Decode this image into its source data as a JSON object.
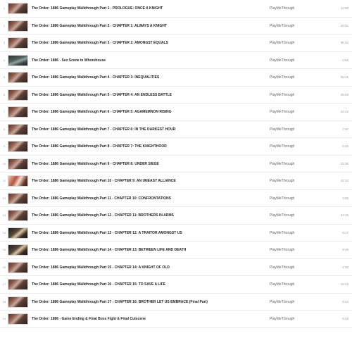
{
  "playlist": {
    "items": [
      {
        "index": "1",
        "title": "The Order: 1886 Gameplay Walkthrough Part 1 - PROLOGUE: ONCE A KNIGHT",
        "channel": "PlayMeThrough",
        "duration": "12:58"
      },
      {
        "index": "2",
        "title": "The Order: 1886 Gameplay Walkthrough Part 2 - CHAPTER 1: ALWAYS A KNIGHT",
        "channel": "PlayMeThrough",
        "duration": "20:01"
      },
      {
        "index": "3",
        "title": "The Order: 1886 Gameplay Walkthrough Part 3 - CHAPTER 2: AMONGST EQUALS",
        "channel": "PlayMeThrough",
        "duration": "35:33"
      },
      {
        "index": "4",
        "title": "The Order: 1886 - Sex Scene in Whorehouse",
        "channel": "PlayMeThrough",
        "duration": "1:56"
      },
      {
        "index": "5",
        "title": "The Order: 1886 Gameplay Walkthrough Part 4 - CHAPTER 3: INEQUALITIES",
        "channel": "PlayMeThrough",
        "duration": "55:41"
      },
      {
        "index": "6",
        "title": "The Order: 1886 Gameplay Walkthrough Part 5 - CHAPTER 4: AN ENDLESS BATTLE",
        "channel": "PlayMeThrough",
        "duration": "26:09"
      },
      {
        "index": "7",
        "title": "The Order: 1886 Gameplay Walkthrough Part 6 - CHAPTER 5: AGAMEMNON RISING",
        "channel": "PlayMeThrough",
        "duration": "22:42"
      },
      {
        "index": "8",
        "title": "The Order: 1886 Gameplay Walkthrough Part 7 - CHAPTER 6: IN THE DARKEST HOUR",
        "channel": "PlayMeThrough",
        "duration": "7:32"
      },
      {
        "index": "9",
        "title": "The Order: 1886 Gameplay Walkthrough Part 8 - CHAPTER 7: THE KNIGHTHOOD",
        "channel": "PlayMeThrough",
        "duration": "6:45"
      },
      {
        "index": "10",
        "title": "The Order: 1886 Gameplay Walkthrough Part 9 - CHAPTER 8: UNDER SIEGE",
        "channel": "PlayMeThrough",
        "duration": "21:38"
      },
      {
        "index": "11",
        "title": "The Order: 1886 Gameplay Walkthrough Part 10 - CHAPTER 9: AN UNEASY ALLIANCE",
        "channel": "PlayMeThrough",
        "duration": "43:10"
      },
      {
        "index": "12",
        "title": "The Order: 1886 Gameplay Walkthrough Part 11 - CHAPTER 10: CONFRONTATIONS",
        "channel": "PlayMeThrough",
        "duration": "4:08"
      },
      {
        "index": "13",
        "title": "The Order: 1886 Gameplay Walkthrough Part 12 - CHAPTER 11: BROTHERS IN ARMS",
        "channel": "PlayMeThrough",
        "duration": "34:16"
      },
      {
        "index": "14",
        "title": "The Order: 1886 Gameplay Walkthrough Part 13 - CHAPTER 12: A TRAITOR AMONGST US",
        "channel": "PlayMeThrough",
        "duration": "8:17"
      },
      {
        "index": "15",
        "title": "The Order: 1886 Gameplay Walkthrough Part 14 - CHAPTER 13: BETWEEN LIFE AND DEATH",
        "channel": "PlayMeThrough",
        "duration": "9:18"
      },
      {
        "index": "16",
        "title": "The Order: 1886 Gameplay Walkthrough Part 15 - CHAPTER 14: A KNIGHT OF OLD",
        "channel": "PlayMeThrough",
        "duration": "2:35"
      },
      {
        "index": "17",
        "title": "The Order: 1886 Gameplay Walkthrough Part 16 - CHAPTER 15: TO SAVE A LIFE",
        "channel": "PlayMeThrough",
        "duration": "13:43"
      },
      {
        "index": "18",
        "title": "The Order: 1886 Gameplay Walkthrough Part 17 - CHAPTER 16: BROTHER LET US EMBRACE (Final Part)",
        "channel": "PlayMeThrough",
        "duration": "9:23"
      },
      {
        "index": "19",
        "title": "The Order: 1886 - Game Ending & Final Boss Fight & Final Cutscene",
        "channel": "PlayMeThrough",
        "duration": "6:26"
      }
    ]
  }
}
